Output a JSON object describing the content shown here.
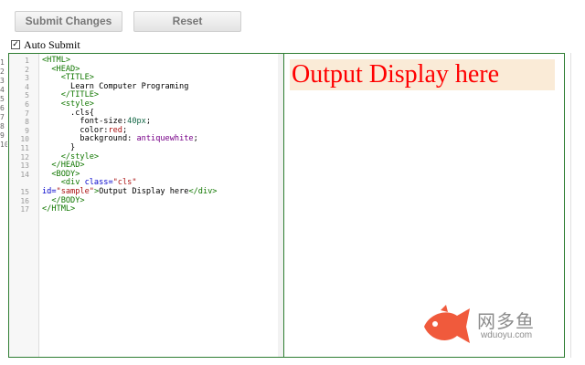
{
  "toolbar": {
    "submit_label": "Submit Changes",
    "reset_label": "Reset"
  },
  "auto_submit": {
    "label": "Auto Submit",
    "checked": true,
    "check_glyph": "✓"
  },
  "left_strip_numbers": [
    "1",
    "2",
    "3",
    "4",
    "5",
    "6",
    "7",
    "8",
    "9",
    "10"
  ],
  "editor": {
    "line_numbers": [
      "1",
      "2",
      "3",
      "4",
      "5",
      "6",
      "7",
      "8",
      "9",
      "10",
      "11",
      "12",
      "13",
      "14",
      "15",
      "16",
      "17"
    ],
    "tokens": {
      "l1": "<HTML>",
      "l2": "<HEAD>",
      "l3": "<TITLE>",
      "l4": "Learn Computer Programing",
      "l5": "</TITLE>",
      "l6": "<style>",
      "l7": ".cls{",
      "l8_prop": "font-size:",
      "l8_val": "40px",
      "l8_end": ";",
      "l9_prop": "color:",
      "l9_val": "red",
      "l9_end": ";",
      "l10_prop": "background: ",
      "l10_val": "antiquewhite",
      "l10_end": ";",
      "l11": "}",
      "l12": "</style>",
      "l13": "</HEAD>",
      "l14": "<BODY>",
      "l15_open": "<div ",
      "l15_attr1": "class=",
      "l15_str1": "\"cls\"",
      "l15_attr2": "id=",
      "l15_str2": "\"sample\"",
      "l15_close": ">",
      "l15_text": "Output Display here",
      "l15_end": "</div>",
      "l16": "</BODY>",
      "l17": "</HTML>"
    }
  },
  "output": {
    "text": "Output Display here",
    "text_color": "#ff0000",
    "background": "antiquewhite"
  },
  "watermark": {
    "cn": "网多鱼",
    "url": "wduoyu.com",
    "fish_color": "#f05a3c"
  },
  "colors": {
    "panel_border": "#2e7d32",
    "tag": "#117700",
    "string": "#aa1111",
    "number": "#116644"
  }
}
